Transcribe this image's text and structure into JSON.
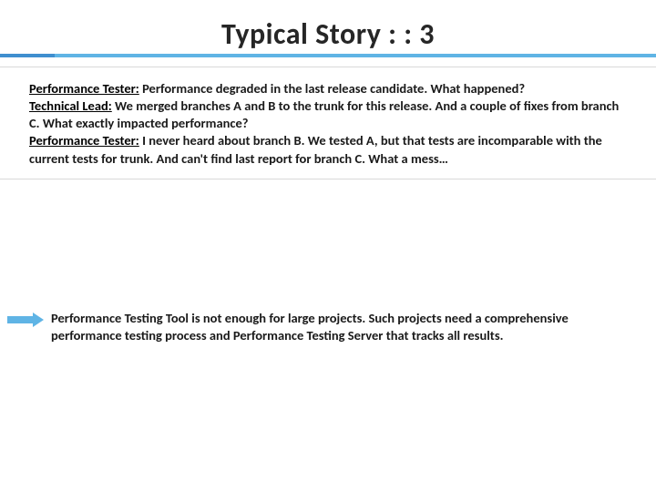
{
  "title": "Typical Story : : 3",
  "dialogue": [
    {
      "speaker": "Performance Tester:",
      "text": " Performance degraded in the last release candidate. What happened?"
    },
    {
      "speaker": "Technical Lead:",
      "text": " We merged branches A and B to the trunk for this release. And a couple of fixes from branch C. What exactly impacted performance?"
    },
    {
      "speaker": "Performance Tester:",
      "text": " I never heard about branch B. We tested A, but that tests are incomparable with the current tests for trunk. And can't find last report for branch C. What a mess…"
    }
  ],
  "conclusion": "Performance Testing Tool is not enough for large projects. Such projects need a comprehensive performance testing process and Performance Testing Server that tracks all results."
}
